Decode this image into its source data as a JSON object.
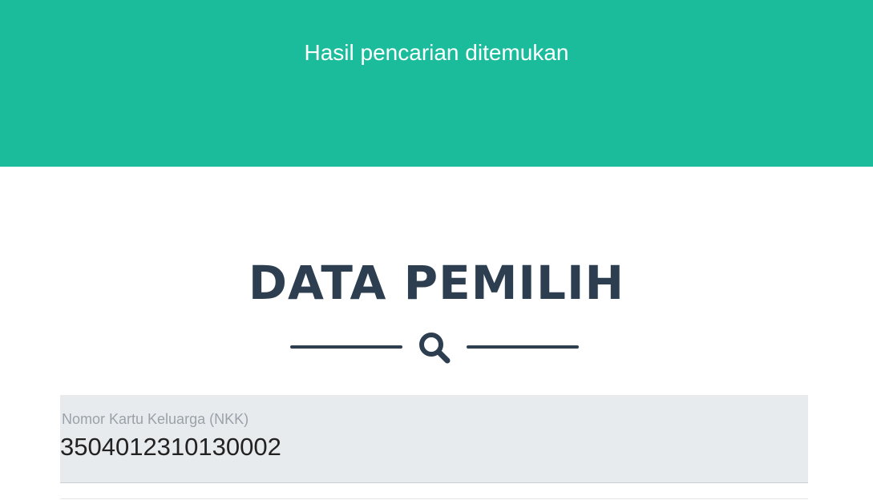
{
  "header": {
    "message": "Hasil pencarian ditemukan",
    "background_color": "#1abc9c"
  },
  "section": {
    "title": "DATA PEMILIH",
    "divider_icon": "search-icon",
    "title_color": "#2c3e50"
  },
  "fields": [
    {
      "label": "Nomor Kartu Keluarga (NKK)",
      "value": "3504012310130002"
    }
  ]
}
